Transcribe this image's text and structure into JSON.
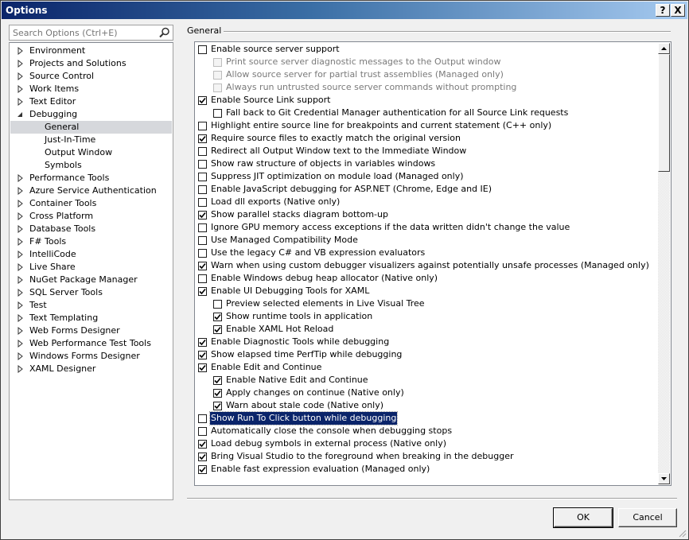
{
  "window": {
    "title": "Options",
    "help_glyph": "?",
    "close_glyph": "X"
  },
  "search": {
    "placeholder": "Search Options (Ctrl+E)"
  },
  "tree": [
    {
      "label": "Environment",
      "level": 0,
      "expandable": true,
      "expanded": false
    },
    {
      "label": "Projects and Solutions",
      "level": 0,
      "expandable": true,
      "expanded": false
    },
    {
      "label": "Source Control",
      "level": 0,
      "expandable": true,
      "expanded": false
    },
    {
      "label": "Work Items",
      "level": 0,
      "expandable": true,
      "expanded": false
    },
    {
      "label": "Text Editor",
      "level": 0,
      "expandable": true,
      "expanded": false
    },
    {
      "label": "Debugging",
      "level": 0,
      "expandable": true,
      "expanded": true
    },
    {
      "label": "General",
      "level": 1,
      "expandable": false,
      "selected": true
    },
    {
      "label": "Just-In-Time",
      "level": 1,
      "expandable": false
    },
    {
      "label": "Output Window",
      "level": 1,
      "expandable": false
    },
    {
      "label": "Symbols",
      "level": 1,
      "expandable": false
    },
    {
      "label": "Performance Tools",
      "level": 0,
      "expandable": true,
      "expanded": false
    },
    {
      "label": "Azure Service Authentication",
      "level": 0,
      "expandable": true,
      "expanded": false
    },
    {
      "label": "Container Tools",
      "level": 0,
      "expandable": true,
      "expanded": false
    },
    {
      "label": "Cross Platform",
      "level": 0,
      "expandable": true,
      "expanded": false
    },
    {
      "label": "Database Tools",
      "level": 0,
      "expandable": true,
      "expanded": false
    },
    {
      "label": "F# Tools",
      "level": 0,
      "expandable": true,
      "expanded": false
    },
    {
      "label": "IntelliCode",
      "level": 0,
      "expandable": true,
      "expanded": false
    },
    {
      "label": "Live Share",
      "level": 0,
      "expandable": true,
      "expanded": false
    },
    {
      "label": "NuGet Package Manager",
      "level": 0,
      "expandable": true,
      "expanded": false
    },
    {
      "label": "SQL Server Tools",
      "level": 0,
      "expandable": true,
      "expanded": false
    },
    {
      "label": "Test",
      "level": 0,
      "expandable": true,
      "expanded": false
    },
    {
      "label": "Text Templating",
      "level": 0,
      "expandable": true,
      "expanded": false
    },
    {
      "label": "Web Forms Designer",
      "level": 0,
      "expandable": true,
      "expanded": false
    },
    {
      "label": "Web Performance Test Tools",
      "level": 0,
      "expandable": true,
      "expanded": false
    },
    {
      "label": "Windows Forms Designer",
      "level": 0,
      "expandable": true,
      "expanded": false
    },
    {
      "label": "XAML Designer",
      "level": 0,
      "expandable": true,
      "expanded": false
    }
  ],
  "page": {
    "title": "General"
  },
  "options": [
    {
      "label": "Enable source server support",
      "level": 0,
      "checked": false
    },
    {
      "label": "Print source server diagnostic messages to the Output window",
      "level": 1,
      "checked": false,
      "disabled": true
    },
    {
      "label": "Allow source server for partial trust assemblies (Managed only)",
      "level": 1,
      "checked": false,
      "disabled": true
    },
    {
      "label": "Always run untrusted source server commands without prompting",
      "level": 1,
      "checked": false,
      "disabled": true
    },
    {
      "label": "Enable Source Link support",
      "level": 0,
      "checked": true
    },
    {
      "label": "Fall back to Git Credential Manager authentication for all Source Link requests",
      "level": 1,
      "checked": false
    },
    {
      "label": "Highlight entire source line for breakpoints and current statement (C++ only)",
      "level": 0,
      "checked": false
    },
    {
      "label": "Require source files to exactly match the original version",
      "level": 0,
      "checked": true
    },
    {
      "label": "Redirect all Output Window text to the Immediate Window",
      "level": 0,
      "checked": false
    },
    {
      "label": "Show raw structure of objects in variables windows",
      "level": 0,
      "checked": false
    },
    {
      "label": "Suppress JIT optimization on module load (Managed only)",
      "level": 0,
      "checked": false
    },
    {
      "label": "Enable JavaScript debugging for ASP.NET (Chrome, Edge and IE)",
      "level": 0,
      "checked": false
    },
    {
      "label": "Load dll exports (Native only)",
      "level": 0,
      "checked": false
    },
    {
      "label": "Show parallel stacks diagram bottom-up",
      "level": 0,
      "checked": true
    },
    {
      "label": "Ignore GPU memory access exceptions if the data written didn't change the value",
      "level": 0,
      "checked": false
    },
    {
      "label": "Use Managed Compatibility Mode",
      "level": 0,
      "checked": false
    },
    {
      "label": "Use the legacy C# and VB expression evaluators",
      "level": 0,
      "checked": false
    },
    {
      "label": "Warn when using custom debugger visualizers against potentially unsafe processes (Managed only)",
      "level": 0,
      "checked": true
    },
    {
      "label": "Enable Windows debug heap allocator (Native only)",
      "level": 0,
      "checked": false
    },
    {
      "label": "Enable UI Debugging Tools for XAML",
      "level": 0,
      "checked": true
    },
    {
      "label": "Preview selected elements in Live Visual Tree",
      "level": 1,
      "checked": false
    },
    {
      "label": "Show runtime tools in application",
      "level": 1,
      "checked": true
    },
    {
      "label": "Enable XAML Hot Reload",
      "level": 1,
      "checked": true
    },
    {
      "label": "Enable Diagnostic Tools while debugging",
      "level": 0,
      "checked": true
    },
    {
      "label": "Show elapsed time PerfTip while debugging",
      "level": 0,
      "checked": true
    },
    {
      "label": "Enable Edit and Continue",
      "level": 0,
      "checked": true
    },
    {
      "label": "Enable Native Edit and Continue",
      "level": 1,
      "checked": true
    },
    {
      "label": "Apply changes on continue (Native only)",
      "level": 1,
      "checked": true
    },
    {
      "label": "Warn about stale code (Native only)",
      "level": 1,
      "checked": true
    },
    {
      "label": "Show Run To Click button while debugging",
      "level": 0,
      "checked": false,
      "highlighted": true
    },
    {
      "label": "Automatically close the console when debugging stops",
      "level": 0,
      "checked": false
    },
    {
      "label": "Load debug symbols in external process (Native only)",
      "level": 0,
      "checked": true
    },
    {
      "label": "Bring Visual Studio to the foreground when breaking in the debugger",
      "level": 0,
      "checked": true
    },
    {
      "label": "Enable fast expression evaluation (Managed only)",
      "level": 0,
      "checked": true
    }
  ],
  "buttons": {
    "ok": "OK",
    "cancel": "Cancel"
  },
  "colors": {
    "selection_bg": "#0a246a",
    "tree_selected_bg": "#d6d8dc",
    "dialog_bg": "#f0f0f0"
  }
}
